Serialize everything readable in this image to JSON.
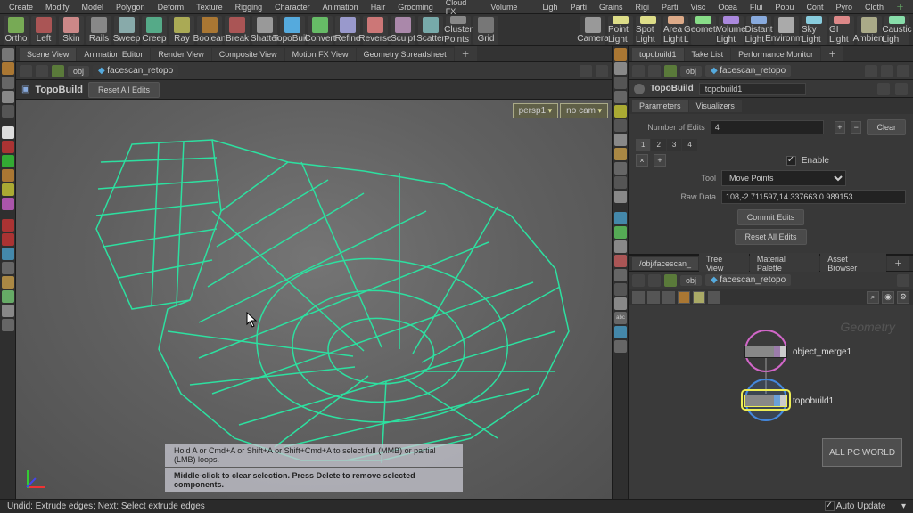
{
  "menu": [
    "Create",
    "Modify",
    "Model",
    "Polygon",
    "Deform",
    "Texture",
    "Rigging",
    "Character",
    "Animation",
    "Hair",
    "Grooming",
    "Cloud FX",
    "Volume"
  ],
  "shelf_left": [
    "Ortho",
    "Left",
    "Skin",
    "Rails",
    "Sweep",
    "Creep",
    "Ray",
    "Boolean",
    "Break",
    "Shatter",
    "TopoBuild",
    "Convert",
    "Refine",
    "Reverse",
    "Sculpt",
    "Scatter",
    "Cluster Points",
    "Grid"
  ],
  "shelf_right": [
    "Camera",
    "Point Light",
    "Spot Light",
    "Area Light",
    "Geometry L",
    "Volume Light",
    "Distant Light",
    "Environme",
    "Sky Light",
    "GI Light",
    "Ambient",
    "Caustic Ligh"
  ],
  "menu_right": [
    "Ligh",
    "Parti",
    "Grains",
    "Rigi",
    "Parti",
    "Visc",
    "Ocea",
    "Flui",
    "Popu",
    "Cont",
    "Pyro",
    "Cloth"
  ],
  "left_pane_tabs": [
    "Scene View",
    "Animation Editor",
    "Render View",
    "Composite View",
    "Motion FX View",
    "Geometry Spreadsheet"
  ],
  "right_top_tabs": [
    "topobuild1",
    "Take List",
    "Performance Monitor"
  ],
  "path_left": {
    "root": "obj",
    "leaf": "facescan_retopo"
  },
  "path_right_top": {
    "root": "obj",
    "leaf": "facescan_retopo"
  },
  "topo": {
    "title": "TopoBuild",
    "reset": "Reset All Edits"
  },
  "vp": {
    "cam": "persp1",
    "nocam": "no cam"
  },
  "hints": {
    "h1": "Hold A or Cmd+A or Shift+A or Shift+Cmd+A to select full (MMB) or partial (LMB) loops.",
    "h2": "Middle-click to clear selection.  Press Delete to remove selected components."
  },
  "node": {
    "type": "TopoBuild",
    "name": "topobuild1"
  },
  "param_tabs": [
    "Parameters",
    "Visualizers"
  ],
  "params": {
    "num_edits_label": "Number of Edits",
    "num_edits": "4",
    "enable": "Enable",
    "tool_label": "Tool",
    "tool": "Move Points",
    "raw_label": "Raw Data",
    "raw": "108,-2.711597,14.337663,0.989153",
    "commit": "Commit Edits",
    "reset": "Reset All Edits",
    "clear": "Clear"
  },
  "net_tabs": [
    "/obj/facescan_",
    "Tree View",
    "Material Palette",
    "Asset Browser"
  ],
  "path_net": {
    "root": "obj",
    "leaf": "facescan_retopo"
  },
  "nodes": {
    "n1": "object_merge1",
    "n2": "topobuild1"
  },
  "ghost": "Geometry",
  "status": {
    "left": "Undid: Extrude edges; Next: Select extrude edges",
    "right": "Auto Update"
  },
  "watermark": {
    "l1": "ALL PC WORLD"
  }
}
